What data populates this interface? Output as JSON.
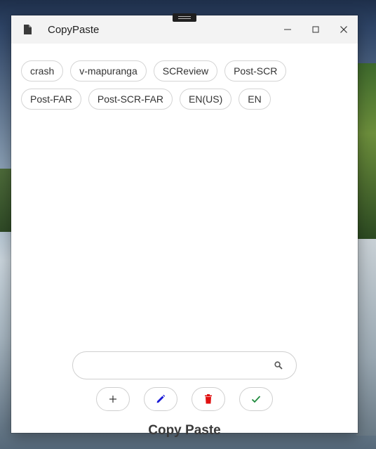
{
  "window": {
    "title": "CopyPaste",
    "icons": {
      "app": "document-icon",
      "minimize": "minimize-icon",
      "maximize": "maximize-icon",
      "close": "close-icon"
    }
  },
  "tags": [
    {
      "label": "crash"
    },
    {
      "label": "v-mapuranga"
    },
    {
      "label": "SCReview"
    },
    {
      "label": "Post-SCR"
    },
    {
      "label": "Post-FAR"
    },
    {
      "label": "Post-SCR-FAR"
    },
    {
      "label": "EN(US)"
    },
    {
      "label": "EN"
    }
  ],
  "search": {
    "value": "",
    "placeholder": "",
    "icon": "search-icon"
  },
  "actions": [
    {
      "name": "add-button",
      "icon": "plus-icon",
      "color": "#333333"
    },
    {
      "name": "edit-button",
      "icon": "pencil-icon",
      "color": "#1a1ad6"
    },
    {
      "name": "delete-button",
      "icon": "trash-icon",
      "color": "#e01010"
    },
    {
      "name": "confirm-button",
      "icon": "check-icon",
      "color": "#1e8a3c"
    }
  ],
  "footer": {
    "title": "Copy Paste"
  }
}
